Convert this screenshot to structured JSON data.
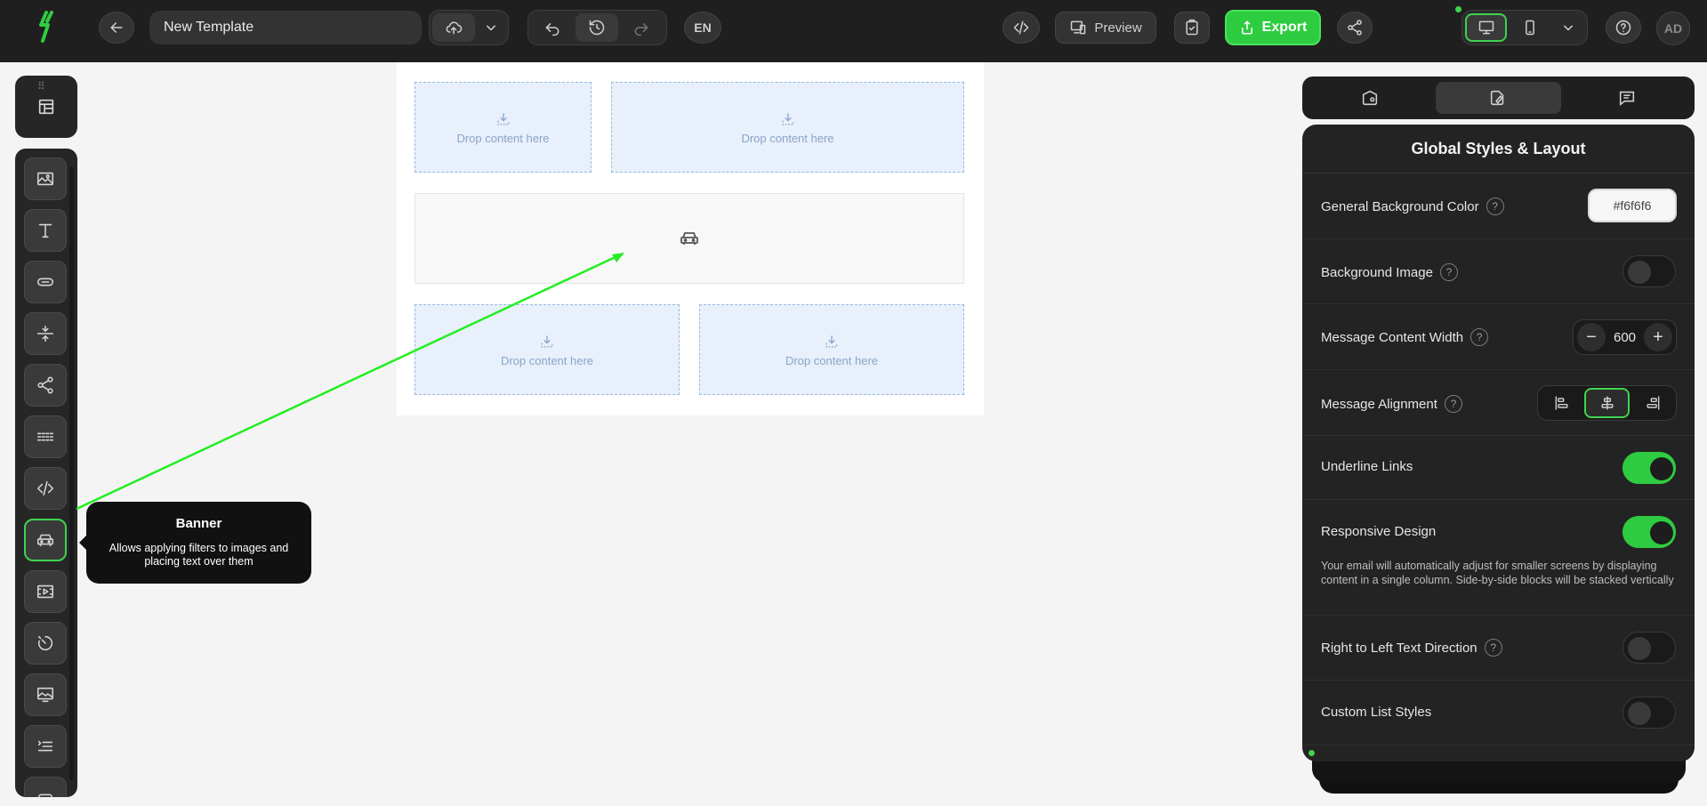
{
  "header": {
    "template_name": "New Template",
    "language": "EN",
    "preview_label": "Preview",
    "export_label": "Export",
    "user_initials": "AD"
  },
  "colors": {
    "accent": "#2ecc40",
    "topbar_bg": "#1f1f1f",
    "panel_bg": "#232323",
    "drop_bg": "#e8f0fb"
  },
  "sidebar": {
    "tools": [
      {
        "name": "image",
        "icon": "image-icon"
      },
      {
        "name": "text",
        "icon": "text-icon"
      },
      {
        "name": "button",
        "icon": "button-icon"
      },
      {
        "name": "spacer",
        "icon": "spacer-icon"
      },
      {
        "name": "social",
        "icon": "share-icon"
      },
      {
        "name": "divider",
        "icon": "divider-icon"
      },
      {
        "name": "html",
        "icon": "code-icon"
      },
      {
        "name": "banner",
        "icon": "car-icon",
        "active": true
      },
      {
        "name": "video",
        "icon": "video-icon"
      },
      {
        "name": "timer",
        "icon": "timer-icon"
      },
      {
        "name": "image-slider",
        "icon": "slider-icon"
      },
      {
        "name": "menu",
        "icon": "menu-list-icon"
      }
    ]
  },
  "tooltip": {
    "title": "Banner",
    "description": "Allows applying filters to images and placing text over them"
  },
  "canvas": {
    "drop_label": "Drop content here"
  },
  "panel": {
    "title": "Global Styles & Layout",
    "rows": {
      "bg_color": {
        "label": "General Background Color",
        "value": "#f6f6f6"
      },
      "bg_image": {
        "label": "Background Image",
        "on": false
      },
      "content_width": {
        "label": "Message Content Width",
        "value": "600",
        "minus": "−",
        "plus": "+"
      },
      "alignment": {
        "label": "Message Alignment",
        "selected": "center"
      },
      "underline": {
        "label": "Underline Links",
        "on": true
      },
      "responsive": {
        "label": "Responsive Design",
        "on": true,
        "note": "Your email will automatically adjust for smaller screens by displaying content in a single column. Side-by-side blocks will be stacked vertically"
      },
      "rtl": {
        "label": "Right to Left Text Direction",
        "on": false
      },
      "list_styles": {
        "label": "Custom List Styles",
        "on": false
      }
    }
  }
}
